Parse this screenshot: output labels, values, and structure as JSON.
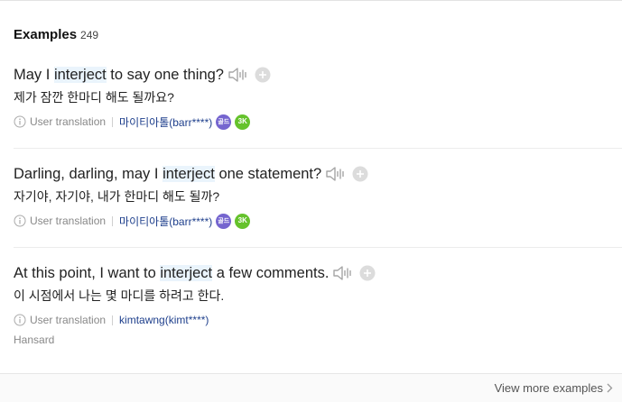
{
  "header": {
    "title": "Examples",
    "count": "249"
  },
  "examples": [
    {
      "pre": "May I ",
      "keyword": "interject",
      "post": " to say one thing?",
      "translation": "제가 잠깐 한마디 해도 될까요?",
      "meta_label": "User translation",
      "user": "마이티아톨(barr****)",
      "rank_badge": "골드",
      "level_badge": "3K",
      "source": ""
    },
    {
      "pre": "Darling, darling, may I ",
      "keyword": "interject",
      "post": " one statement?",
      "translation": "자기야, 자기야, 내가 한마디 해도 될까?",
      "meta_label": "User translation",
      "user": "마이티아톨(barr****)",
      "rank_badge": "골드",
      "level_badge": "3K",
      "source": ""
    },
    {
      "pre": "At this point, I want to ",
      "keyword": "interject",
      "post": " a few comments.",
      "translation": "이 시점에서 나는 몇 마디를 하려고 한다.",
      "meta_label": "User translation",
      "user": "kimtawng(kimt****)",
      "source": "Hansard"
    }
  ],
  "footer": {
    "more_label": "View more examples"
  },
  "colors": {
    "highlight": "#eaf4fc",
    "user_link": "#1e3f8c",
    "rank_badge": "#7565cf",
    "level_badge": "#65c22c"
  }
}
